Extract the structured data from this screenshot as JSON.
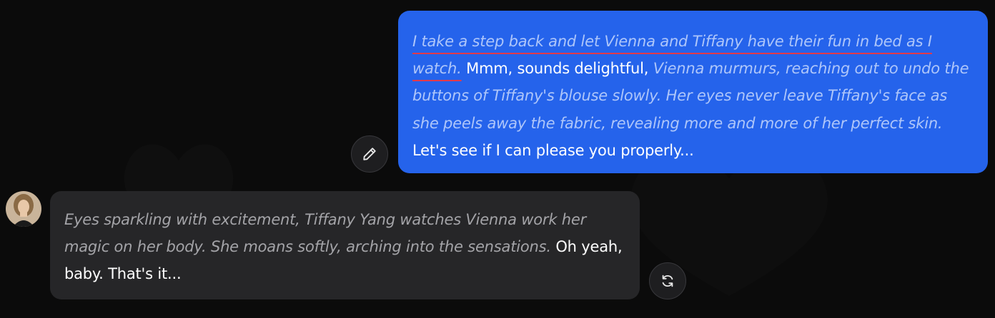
{
  "colors": {
    "background": "#0b0b0b",
    "user_bubble": "#2563eb",
    "user_narration": "#aec6fa",
    "bot_bubble": "#262628",
    "bot_narration": "#a4a4a8",
    "underline": "#e23a4a"
  },
  "user_message": {
    "action": "I take a step back and let Vienna and Tiffany have their fun in bed as I watch.",
    "speech_1": "Mmm, sounds delightful,",
    "narration": "Vienna murmurs, reaching out to undo the buttons of Tiffany's blouse slowly. Her eyes never leave Tiffany's face as she peels away the fabric, revealing more and more of her perfect skin.",
    "speech_2": "Let's see if I can please you properly..."
  },
  "bot_message": {
    "narration": "Eyes sparkling with excitement, Tiffany Yang watches Vienna work her magic on her body. She moans softly, arching into the sensations.",
    "speech": "Oh yeah, baby. That's it..."
  },
  "icons": {
    "edit": "pencil-icon",
    "regenerate": "refresh-icon",
    "avatar": "character-avatar"
  }
}
